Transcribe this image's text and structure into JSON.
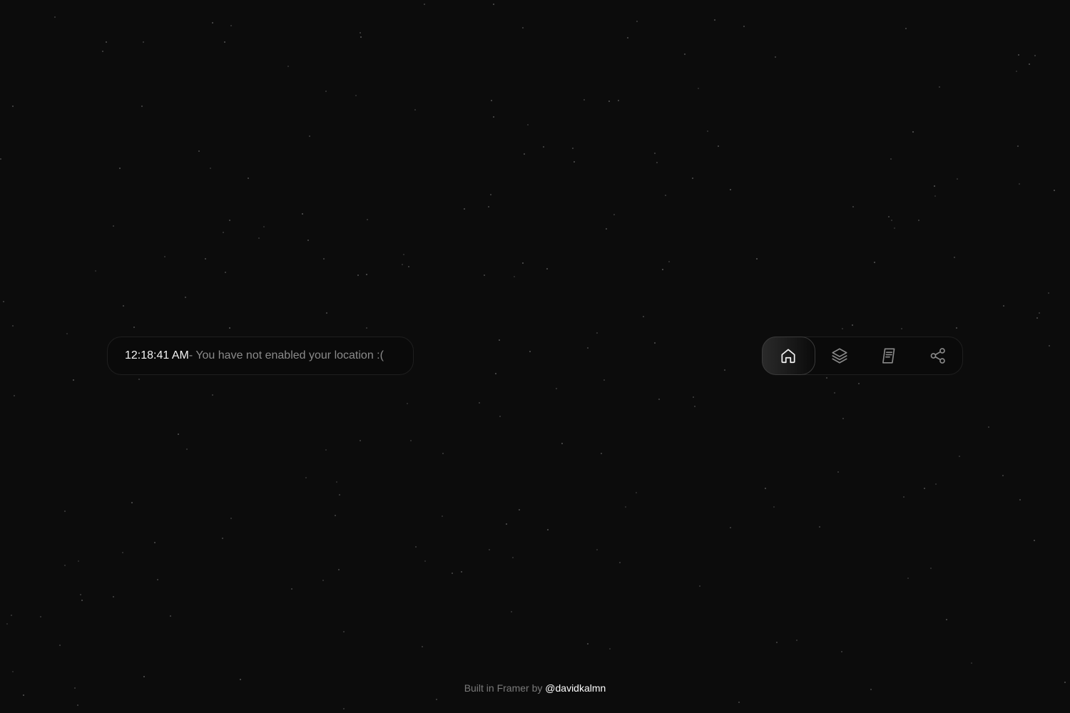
{
  "status": {
    "time": "12:18:41 AM",
    "message": "- You have not enabled your location :("
  },
  "nav": {
    "items": [
      {
        "name": "home",
        "icon": "home-icon",
        "active": true
      },
      {
        "name": "layers",
        "icon": "layers-icon",
        "active": false
      },
      {
        "name": "notes",
        "icon": "document-icon",
        "active": false
      },
      {
        "name": "share",
        "icon": "share-icon",
        "active": false
      }
    ]
  },
  "footer": {
    "prefix": "Built in Framer by ",
    "handle": "@davidkalmn"
  },
  "colors": {
    "background": "#0c0c0c",
    "text_primary": "#f2f2f2",
    "text_muted": "#8a8a8a",
    "icon_active": "#f2f2f2",
    "icon_inactive": "#8a8a8a"
  }
}
